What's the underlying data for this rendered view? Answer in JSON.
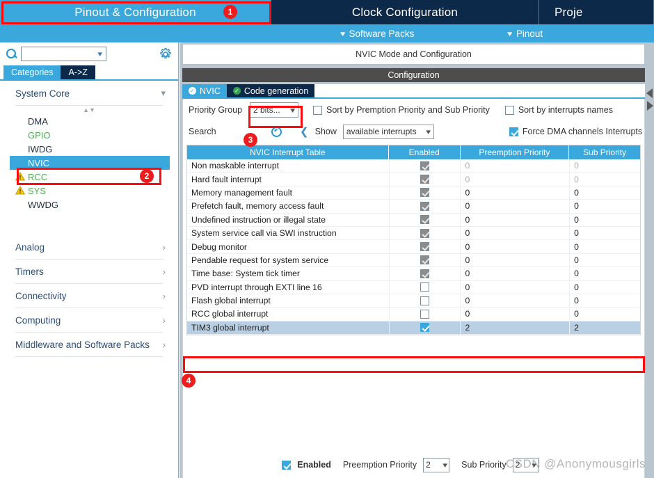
{
  "topbar": {
    "tabs": [
      {
        "label": "Pinout & Configuration",
        "selected": true
      },
      {
        "label": "Clock Configuration",
        "selected": false
      },
      {
        "label": "Proje",
        "selected": false
      }
    ]
  },
  "subbar": {
    "software_packs": "Software Packs",
    "pinout": "Pinout"
  },
  "sidebar": {
    "search_value": "",
    "gear_icon": "gear-icon",
    "tabs": [
      {
        "label": "Categories",
        "selected": true
      },
      {
        "label": "A->Z",
        "selected": false
      }
    ],
    "groups": [
      {
        "label": "System Core",
        "expanded": true
      },
      {
        "label": "Analog",
        "expanded": false
      },
      {
        "label": "Timers",
        "expanded": false
      },
      {
        "label": "Connectivity",
        "expanded": false
      },
      {
        "label": "Computing",
        "expanded": false
      },
      {
        "label": "Middleware and Software Packs",
        "expanded": false
      }
    ],
    "system_core_items": [
      {
        "label": "DMA",
        "state": "dark",
        "warning": false,
        "selected": false
      },
      {
        "label": "GPIO",
        "state": "green",
        "warning": false,
        "selected": false
      },
      {
        "label": "IWDG",
        "state": "dark",
        "warning": false,
        "selected": false
      },
      {
        "label": "NVIC",
        "state": "selected",
        "warning": false,
        "selected": true
      },
      {
        "label": "RCC",
        "state": "green",
        "warning": true,
        "selected": false
      },
      {
        "label": "SYS",
        "state": "green",
        "warning": true,
        "selected": false
      },
      {
        "label": "WWDG",
        "state": "dark",
        "warning": false,
        "selected": false
      }
    ]
  },
  "main": {
    "mode_title": "NVIC Mode and Configuration",
    "configuration_label": "Configuration",
    "tabs": [
      {
        "label": "NVIC",
        "selected": true
      },
      {
        "label": "Code generation",
        "selected": false
      }
    ],
    "options": {
      "priority_group_label": "Priority Group",
      "priority_group_value": "2 bits...",
      "sort_by_premption_label": "Sort by Premption Priority and Sub Priority",
      "sort_by_premption_checked": false,
      "sort_by_names_label": "Sort by interrupts names",
      "sort_by_names_checked": false,
      "search_label": "Search",
      "show_label": "Show",
      "show_value": "available interrupts",
      "force_dma_label": "Force DMA channels Interrupts",
      "force_dma_checked": true
    },
    "table": {
      "columns": [
        "NVIC Interrupt Table",
        "Enabled",
        "Preemption Priority",
        "Sub Priority"
      ],
      "rows": [
        {
          "name": "Non maskable interrupt",
          "enabled": "disabled-checked",
          "preemption": "0",
          "sub": "0",
          "gray": true,
          "selected": false
        },
        {
          "name": "Hard fault interrupt",
          "enabled": "disabled-checked",
          "preemption": "0",
          "sub": "0",
          "gray": true,
          "selected": false
        },
        {
          "name": "Memory management fault",
          "enabled": "disabled-checked",
          "preemption": "0",
          "sub": "0",
          "gray": false,
          "selected": false
        },
        {
          "name": "Prefetch fault, memory access fault",
          "enabled": "disabled-checked",
          "preemption": "0",
          "sub": "0",
          "gray": false,
          "selected": false
        },
        {
          "name": "Undefined instruction or illegal state",
          "enabled": "disabled-checked",
          "preemption": "0",
          "sub": "0",
          "gray": false,
          "selected": false
        },
        {
          "name": "System service call via SWI instruction",
          "enabled": "disabled-checked",
          "preemption": "0",
          "sub": "0",
          "gray": false,
          "selected": false
        },
        {
          "name": "Debug monitor",
          "enabled": "disabled-checked",
          "preemption": "0",
          "sub": "0",
          "gray": false,
          "selected": false
        },
        {
          "name": "Pendable request for system service",
          "enabled": "disabled-checked",
          "preemption": "0",
          "sub": "0",
          "gray": false,
          "selected": false
        },
        {
          "name": "Time base: System tick timer",
          "enabled": "disabled-checked",
          "preemption": "0",
          "sub": "0",
          "gray": false,
          "selected": false
        },
        {
          "name": "PVD interrupt through EXTI line 16",
          "enabled": "unchecked",
          "preemption": "0",
          "sub": "0",
          "gray": false,
          "selected": false
        },
        {
          "name": "Flash global interrupt",
          "enabled": "unchecked",
          "preemption": "0",
          "sub": "0",
          "gray": false,
          "selected": false
        },
        {
          "name": "RCC global interrupt",
          "enabled": "unchecked",
          "preemption": "0",
          "sub": "0",
          "gray": false,
          "selected": false
        },
        {
          "name": "TIM3 global interrupt",
          "enabled": "checked",
          "preemption": "2",
          "sub": "2",
          "gray": false,
          "selected": true
        }
      ]
    },
    "footer": {
      "enabled_label": "Enabled",
      "enabled_checked": true,
      "preemption_label": "Preemption Priority",
      "preemption_value": "2",
      "sub_label": "Sub Priority",
      "sub_value": "2"
    }
  },
  "annotations": {
    "badges": [
      "1",
      "2",
      "3",
      "4"
    ],
    "color": "#ee1c1c"
  },
  "watermark": "CSDN @Anonymousgirls"
}
